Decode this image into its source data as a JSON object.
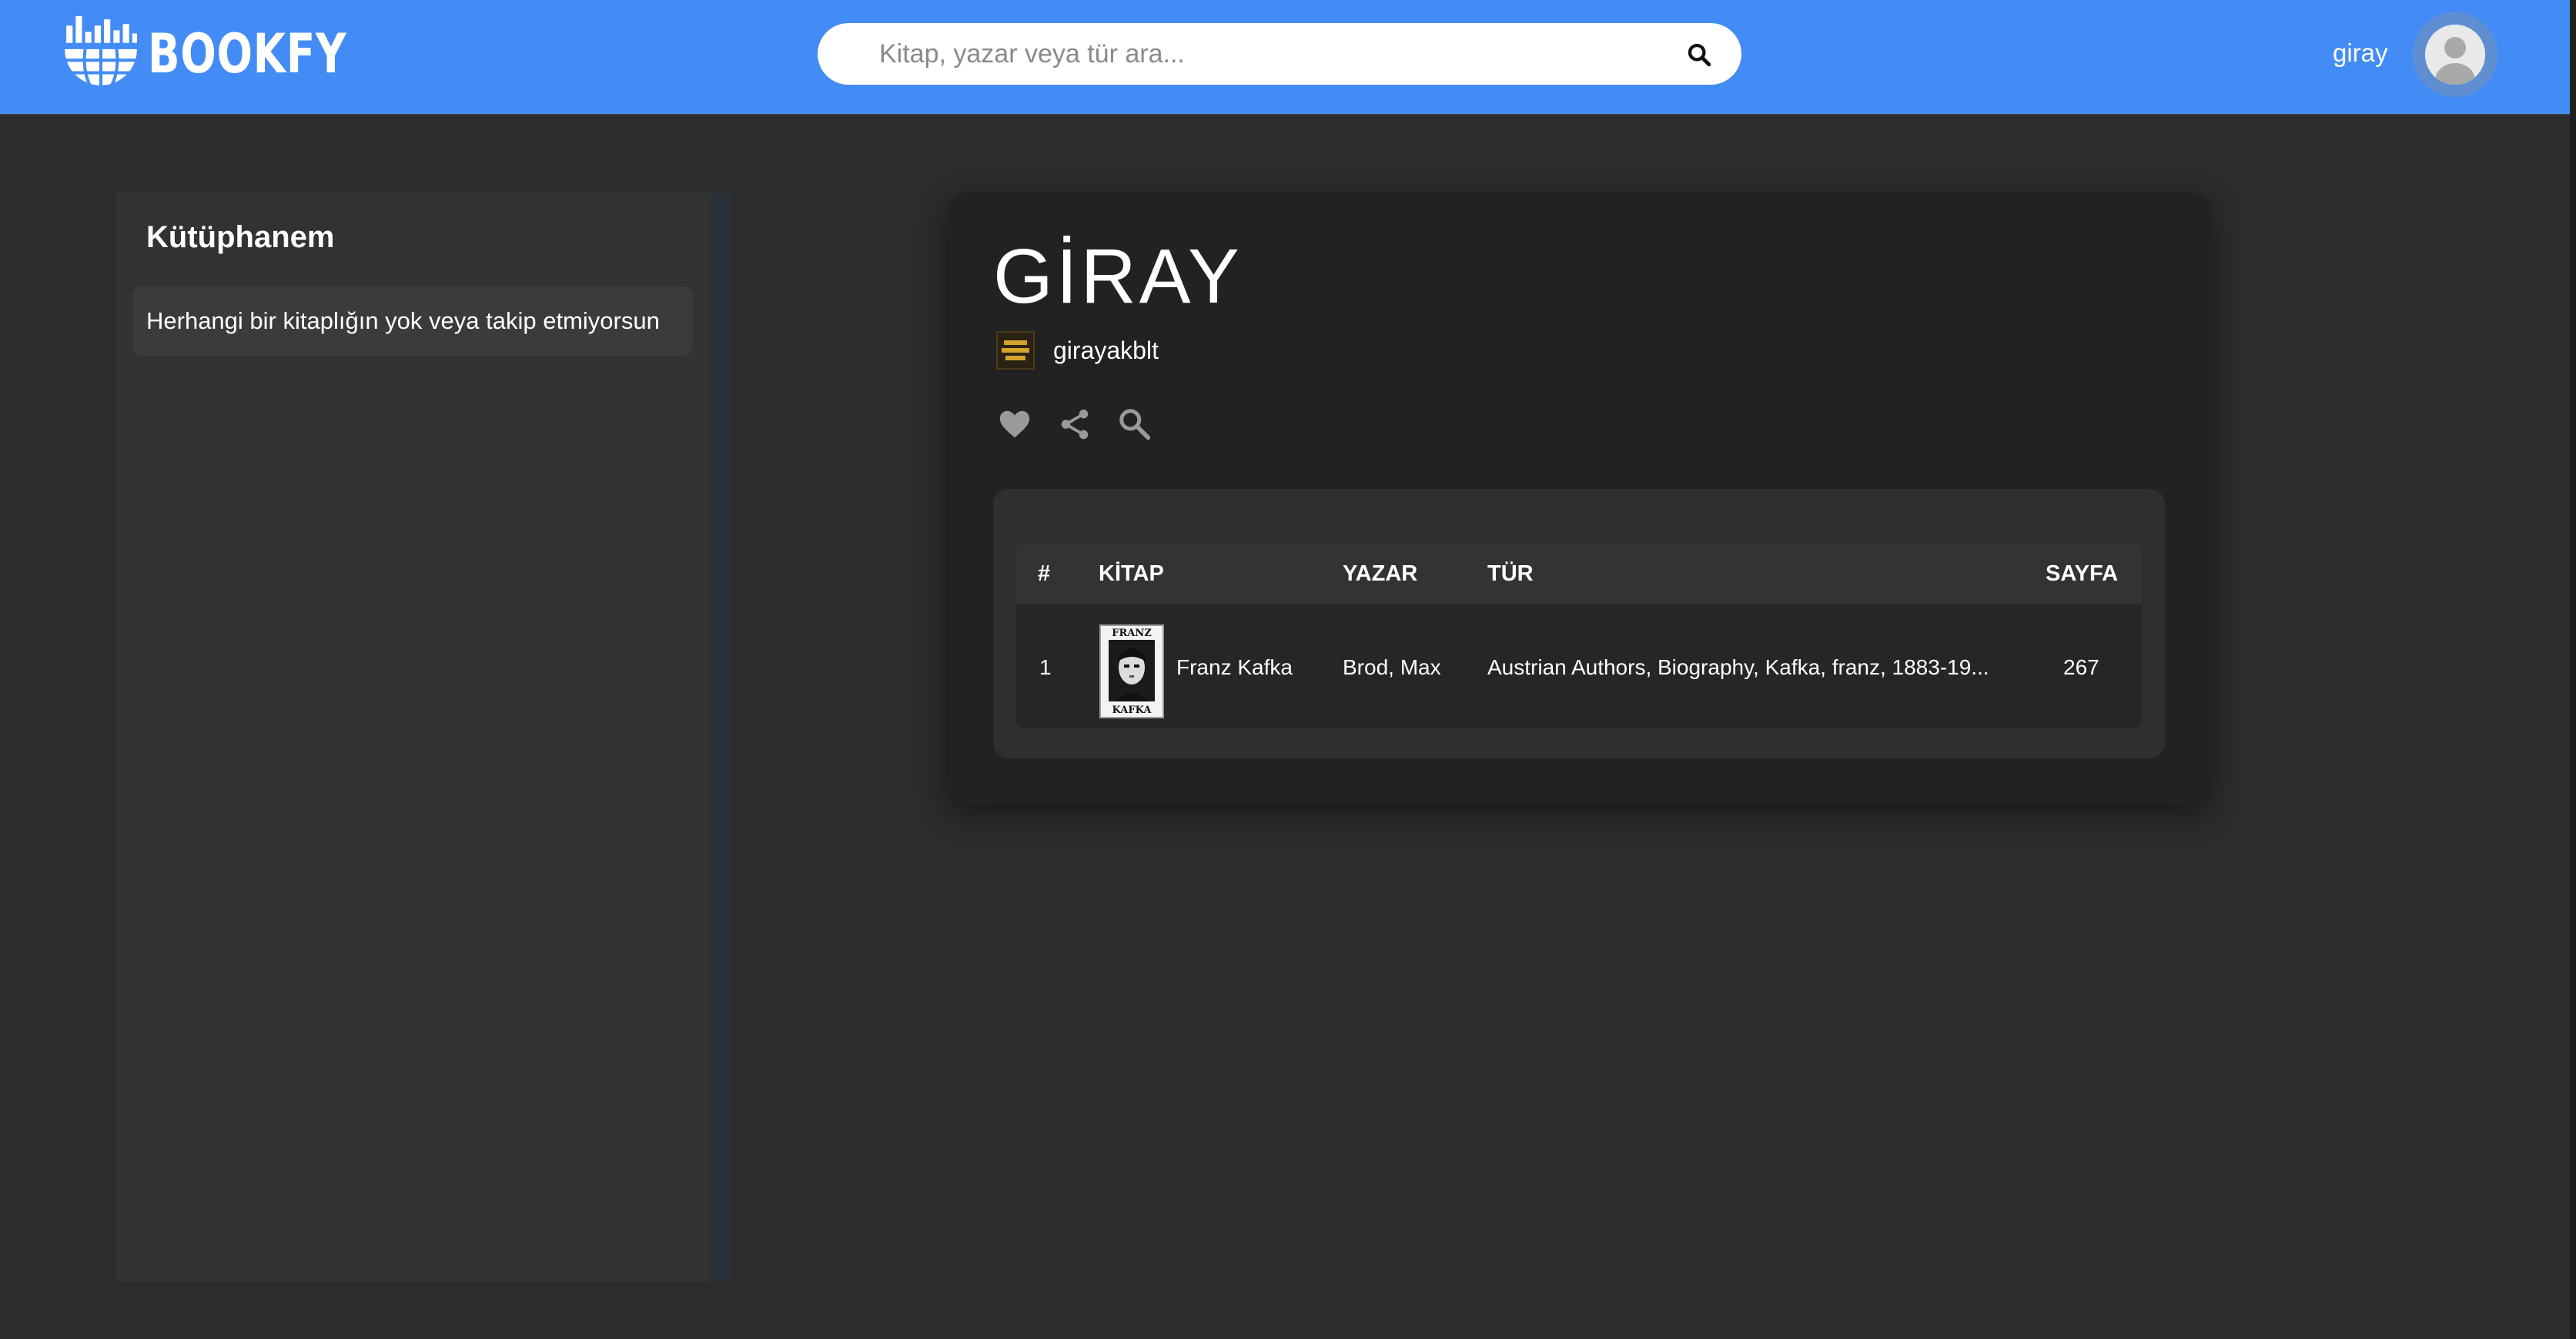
{
  "colors": {
    "accent": "#448cf5",
    "page_bg": "#2c2c2c",
    "card_bg": "#222222"
  },
  "brand": {
    "name": "BOOKFY",
    "icon": "globe-bars-logo"
  },
  "search": {
    "placeholder": "Kitap, yazar veya tür ara...",
    "value": "",
    "icon": "search-icon"
  },
  "user": {
    "name": "giray",
    "avatar_icon": "user-avatar-icon"
  },
  "sidebar": {
    "title": "Kütüphanem",
    "empty_message": "Herhangi bir kitaplığın yok veya takip etmiyorsun"
  },
  "library": {
    "title": "GİRAY",
    "owner": "girayakblt",
    "actions": [
      "heart-icon",
      "share-icon",
      "search-icon"
    ]
  },
  "table": {
    "headers": {
      "index": "#",
      "book": "KİTAP",
      "author": "YAZAR",
      "genre": "TÜR",
      "pages": "SAYFA"
    },
    "rows": [
      {
        "index": "1",
        "title": "Franz Kafka",
        "author": "Brod, Max",
        "genre": "Austrian Authors, Biography, Kafka, franz, 1883-19...",
        "pages": "267",
        "cover_text_top": "FRANZ",
        "cover_text_bottom": "KAFKA"
      }
    ]
  }
}
